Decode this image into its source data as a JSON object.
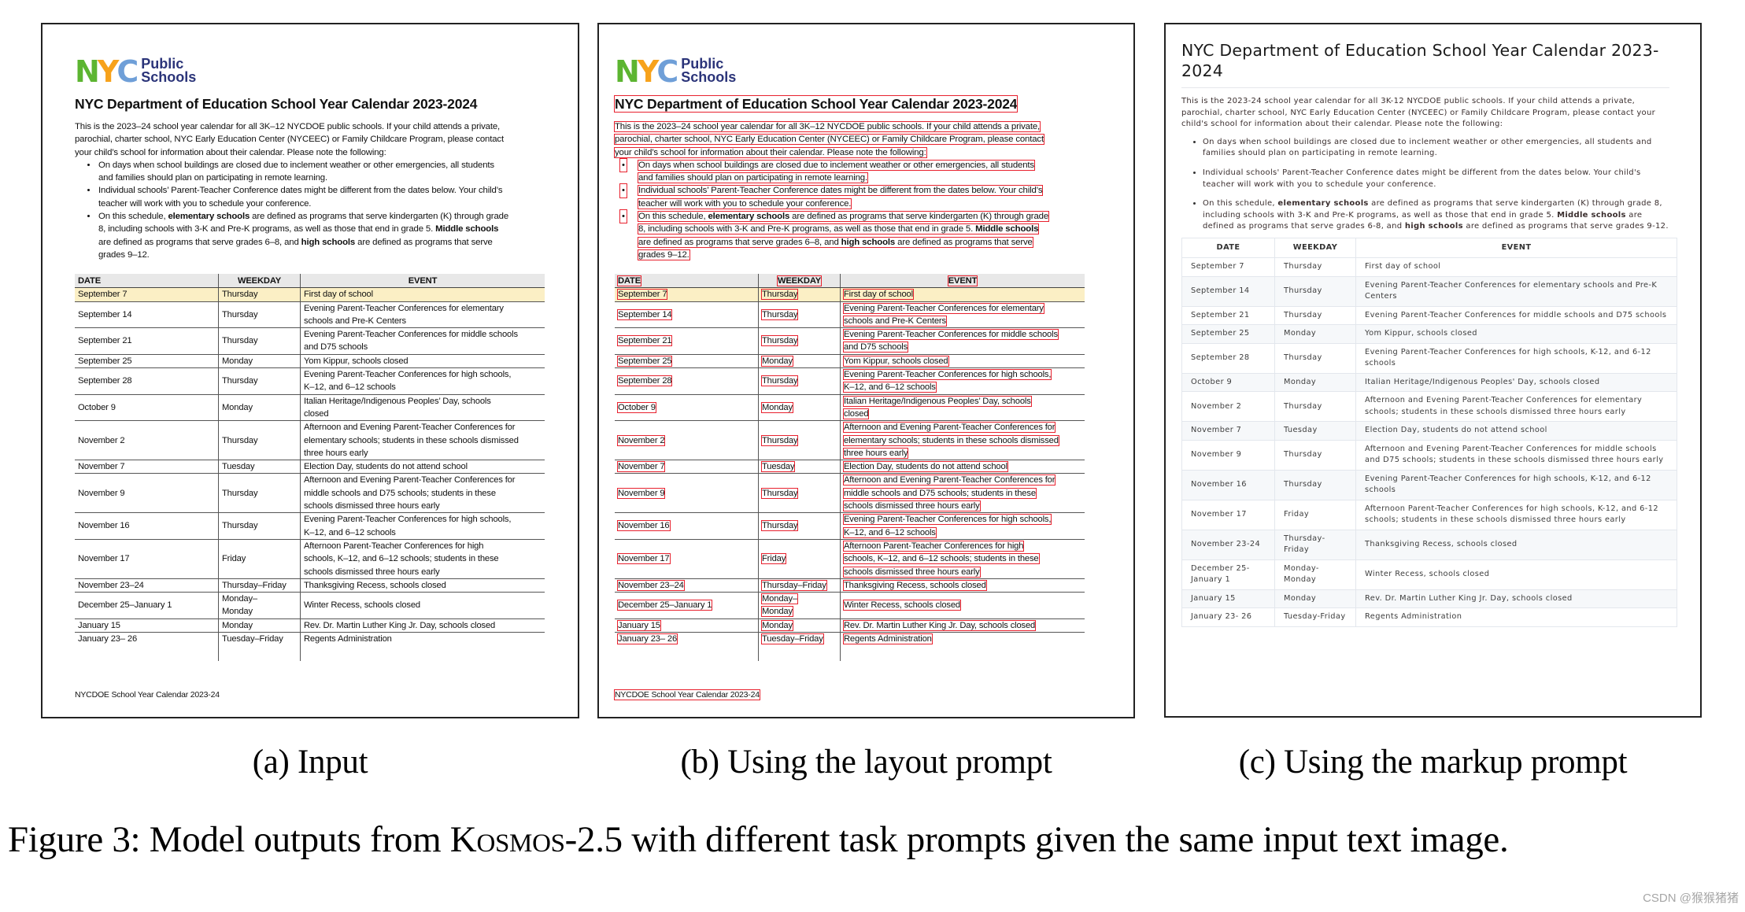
{
  "figure": {
    "caption_prefix": "Figure 3: Model outputs from ",
    "caption_model": "Kosmos-2.5",
    "caption_suffix": " with different task prompts given the same input text image.",
    "subcaptions": [
      "(a) Input",
      "(b) Using the layout prompt",
      "(c) Using the markup prompt"
    ],
    "watermark": "CSDN @猴猴猪猪"
  },
  "document": {
    "logo": {
      "letters": [
        "N",
        "Y",
        "C"
      ],
      "text_line1": "Public",
      "text_line2": "Schools",
      "colors": {
        "n": "#5cb531",
        "y": "#f7a21b",
        "c": "#6f9fd8",
        "text": "#2b3479"
      }
    },
    "title": "NYC Department of Education School Year Calendar 2023-2024",
    "intro_lines": [
      "This is the 2023–24 school year calendar for all 3K–12 NYCDOE public schools. If your child attends a private,",
      "parochial, charter school, NYC Early Education Center (NYCEEC) or Family Childcare Program, please contact",
      "your child’s school for information about their calendar. Please note the following:"
    ],
    "bullets": [
      {
        "lines": [
          "On days when school buildings are closed due to inclement weather or other emergencies, all students",
          "and families should plan on participating in remote learning."
        ]
      },
      {
        "lines": [
          "Individual schools’ Parent-Teacher Conference dates might be different from the dates below. Your child’s",
          "teacher will work with you to schedule your conference."
        ]
      },
      {
        "parts": [
          [
            "On this schedule, ",
            {
              "b": "elementary schools"
            },
            " are defined as programs that serve kindergarten (K) through grade"
          ],
          [
            "8, including schools with 3-K and Pre-K programs, as well as those that end in grade 5. ",
            {
              "b": "Middle schools"
            }
          ],
          [
            "are defined as programs that serve grades 6–8, and ",
            {
              "b": "high schools"
            },
            " are defined as programs that serve"
          ],
          [
            "grades 9–12."
          ]
        ]
      }
    ],
    "table": {
      "headers": [
        "DATE",
        "WEEKDAY",
        "EVENT"
      ],
      "highlight_color": "#fbefc5",
      "rows": [
        {
          "date": [
            "September 7"
          ],
          "weekday": [
            "Thursday"
          ],
          "event": [
            "First day of school"
          ],
          "highlight": true
        },
        {
          "date": [
            "September 14"
          ],
          "weekday": [
            "Thursday"
          ],
          "event": [
            "Evening Parent-Teacher Conferences for elementary",
            "schools and Pre-K Centers"
          ]
        },
        {
          "date": [
            "September 21"
          ],
          "weekday": [
            "Thursday"
          ],
          "event": [
            "Evening Parent-Teacher Conferences for middle schools",
            "and D75 schools"
          ]
        },
        {
          "date": [
            "September 25"
          ],
          "weekday": [
            "Monday"
          ],
          "event": [
            "Yom Kippur, schools closed"
          ]
        },
        {
          "date": [
            "September 28"
          ],
          "weekday": [
            "Thursday"
          ],
          "event": [
            "Evening Parent-Teacher Conferences for high schools,",
            "K–12, and 6–12 schools"
          ]
        },
        {
          "date": [
            "October 9"
          ],
          "weekday": [
            "Monday"
          ],
          "event": [
            "Italian Heritage/Indigenous Peoples’ Day, schools",
            "closed"
          ]
        },
        {
          "date": [
            "November 2"
          ],
          "weekday": [
            "Thursday"
          ],
          "event": [
            "Afternoon and Evening Parent-Teacher Conferences for",
            "elementary schools; students in these schools dismissed",
            "three hours early"
          ]
        },
        {
          "date": [
            "November 7"
          ],
          "weekday": [
            "Tuesday"
          ],
          "event": [
            "Election Day, students do not attend school"
          ]
        },
        {
          "date": [
            "November 9"
          ],
          "weekday": [
            "Thursday"
          ],
          "event": [
            "Afternoon and Evening Parent-Teacher Conferences for",
            "middle schools and D75 schools; students in these",
            "schools dismissed three hours early"
          ]
        },
        {
          "date": [
            "November 16"
          ],
          "weekday": [
            "Thursday"
          ],
          "event": [
            "Evening Parent-Teacher Conferences for high schools,",
            "K–12, and 6–12 schools"
          ]
        },
        {
          "date": [
            "November 17"
          ],
          "weekday": [
            "Friday"
          ],
          "event": [
            "Afternoon Parent-Teacher Conferences for high",
            "schools, K–12, and 6–12 schools; students in these",
            "schools dismissed three hours early"
          ]
        },
        {
          "date": [
            "November 23–24"
          ],
          "weekday": [
            "Thursday–Friday"
          ],
          "event": [
            "Thanksgiving Recess, schools closed"
          ]
        },
        {
          "date": [
            "December 25–January 1"
          ],
          "weekday": [
            "Monday–",
            "Monday"
          ],
          "event": [
            "Winter Recess, schools closed"
          ]
        },
        {
          "date": [
            "January 15"
          ],
          "weekday": [
            "Monday"
          ],
          "event": [
            "Rev. Dr. Martin Luther King Jr. Day, schools closed"
          ]
        },
        {
          "date": [
            "January 23– 26"
          ],
          "weekday": [
            "Tuesday–Friday"
          ],
          "event": [
            "Regents Administration"
          ]
        }
      ]
    },
    "footer": "NYCDOE School Year Calendar 2023-24"
  },
  "layout_output": {
    "box_color": "#e8212e"
  },
  "markup_output": {
    "title": "NYC Department of Education School Year Calendar 2023-2024",
    "intro": "This is the 2023-24 school year calendar for all 3K-12 NYCDOE public schools. If your child attends a private, parochial, charter school, NYC Early Education Center (NYCEEC) or Family Childcare Program, please contact your child's school for information about their calendar. Please note the following:",
    "bullets": [
      [
        "On days when school buildings are closed due to inclement weather or other emergencies, all students and families should plan on participating in remote learning."
      ],
      [
        "Individual schools' Parent-Teacher Conference dates might be different from the dates below. Your child's teacher will work with you to schedule your conference."
      ],
      [
        "On this schedule, ",
        {
          "b": "elementary schools"
        },
        " are defined as programs that serve kindergarten (K) through grade 8, including schools with 3-K and Pre-K programs, as well as those that end in grade 5. ",
        {
          "b": "Middle schools"
        },
        " are defined as programs that serve grades 6-8, and ",
        {
          "b": "high schools"
        },
        " are defined as programs that serve grades 9-12."
      ]
    ],
    "table": {
      "headers": [
        "DATE",
        "WEEKDAY",
        "EVENT"
      ],
      "rows": [
        [
          "September 7",
          "Thursday",
          "First day of school"
        ],
        [
          "September 14",
          "Thursday",
          "Evening Parent-Teacher Conferences for elementary schools and Pre-K Centers"
        ],
        [
          "September 21",
          "Thursday",
          "Evening Parent-Teacher Conferences for middle schools and D75 schools"
        ],
        [
          "September 25",
          "Monday",
          "Yom Kippur, schools closed"
        ],
        [
          "September 28",
          "Thursday",
          "Evening Parent-Teacher Conferences for high schools, K-12, and 6-12 schools"
        ],
        [
          "October 9",
          "Monday",
          "Italian Heritage/Indigenous Peoples' Day, schools closed"
        ],
        [
          "November 2",
          "Thursday",
          "Afternoon and Evening Parent-Teacher Conferences for elementary schools; students in these schools dismissed three hours early"
        ],
        [
          "November 7",
          "Tuesday",
          "Election Day, students do not attend school"
        ],
        [
          "November 9",
          "Thursday",
          "Afternoon and Evening Parent-Teacher Conferences for middle schools and D75 schools; students in these schools dismissed three hours early"
        ],
        [
          "November 16",
          "Thursday",
          "Evening Parent-Teacher Conferences for high schools, K-12, and 6-12 schools"
        ],
        [
          "November 17",
          "Friday",
          "Afternoon Parent-Teacher Conferences for high schools, K-12, and 6-12 schools; students in these schools dismissed three hours early"
        ],
        [
          "November 23-24",
          "Thursday-Friday",
          "Thanksgiving Recess, schools closed"
        ],
        [
          "December 25-January 1",
          "Monday-Monday",
          "Winter Recess, schools closed"
        ],
        [
          "January 15",
          "Monday",
          "Rev. Dr. Martin Luther King Jr. Day, schools closed"
        ],
        [
          "January 23- 26",
          "Tuesday-Friday",
          "Regents Administration"
        ]
      ]
    }
  }
}
